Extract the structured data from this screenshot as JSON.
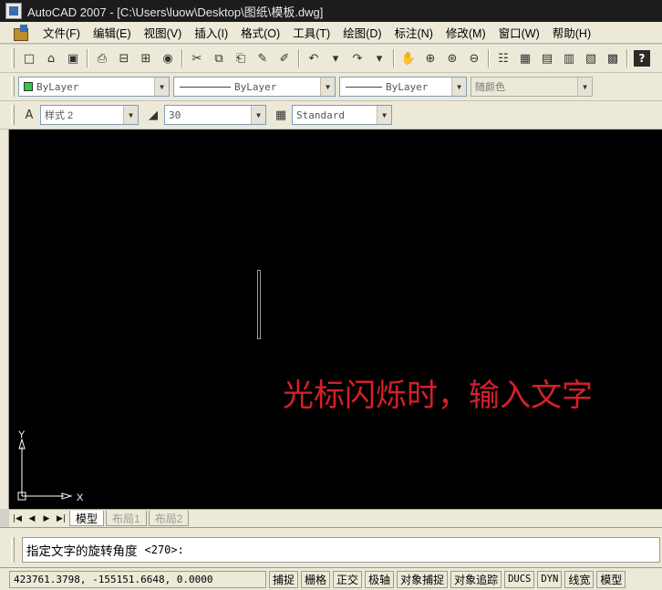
{
  "window": {
    "title": "AutoCAD 2007 - [C:\\Users\\luow\\Desktop\\图纸\\模板.dwg]"
  },
  "menu": {
    "items": [
      "文件(F)",
      "编辑(E)",
      "视图(V)",
      "插入(I)",
      "格式(O)",
      "工具(T)",
      "绘图(D)",
      "标注(N)",
      "修改(M)",
      "窗口(W)",
      "帮助(H)"
    ]
  },
  "properties_toolbar": {
    "layer_value": "ByLayer",
    "linetype_value": "ByLayer",
    "lineweight_value": "ByLayer",
    "plotstyle_value": "随颜色",
    "layer_swatch_color": "#2ecc40"
  },
  "styles_toolbar": {
    "text_style": "样式 2",
    "dim_scale": "30",
    "dim_style": "Standard"
  },
  "canvas": {
    "background": "#000000",
    "annotation_text": "光标闪烁时，输入文字",
    "annotation_color": "#d4202b",
    "ucs_x_label": "X",
    "ucs_y_label": "Y"
  },
  "layout_tabs": {
    "tabs": [
      "模型",
      "布局1",
      "布局2"
    ],
    "active": "模型"
  },
  "command": {
    "prompt": "指定文字的旋转角度",
    "default_value": "<270>:"
  },
  "status": {
    "coordinates": "423761.3798, -155151.6648, 0.0000",
    "buttons": [
      "捕捉",
      "栅格",
      "正交",
      "极轴",
      "对象捕捉",
      "对象追踪",
      "DUCS",
      "DYN",
      "线宽",
      "模型"
    ]
  }
}
